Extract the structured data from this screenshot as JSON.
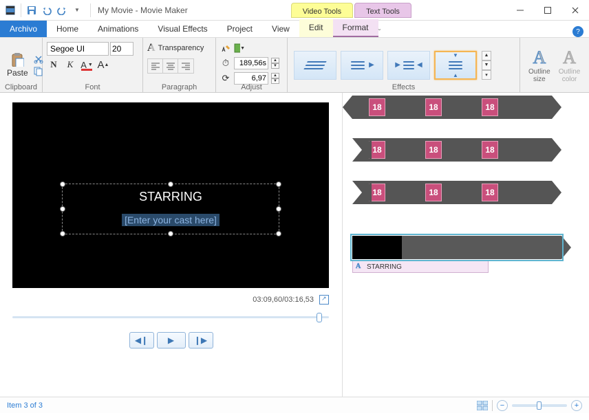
{
  "qat": {
    "save": "save-icon",
    "undo": "undo-icon",
    "redo": "redo-icon"
  },
  "title": "My Movie - Movie Maker",
  "contextual": {
    "video": "Video Tools",
    "text": "Text Tools"
  },
  "tabs": {
    "file": "Archivo",
    "home": "Home",
    "animations": "Animations",
    "visual_effects": "Visual Effects",
    "project": "Project",
    "view": "View",
    "edit": "Edit",
    "format": "Format"
  },
  "groups": {
    "clipboard": {
      "label": "Clipboard",
      "paste": "Paste"
    },
    "font": {
      "label": "Font",
      "family": "Segoe UI",
      "size": "20",
      "bold": "N",
      "italic": "K",
      "color": "A",
      "grow": "A"
    },
    "paragraph": {
      "label": "Paragraph",
      "transparency": "Transparency"
    },
    "adjust": {
      "label": "Adjust",
      "start": "189,56s",
      "duration": "6,97"
    },
    "effects": {
      "label": "Effects"
    },
    "outline": {
      "size": "Outline\nsize",
      "color": "Outline\ncolor"
    }
  },
  "preview": {
    "title_text": "STARRING",
    "placeholder": "[Enter your cast here]",
    "time": "03:09,60/03:16,53",
    "seek_percent": 96
  },
  "timeline": {
    "rating": "18",
    "caption_label": "STARRING"
  },
  "status": {
    "text": "Item 3 of 3"
  }
}
